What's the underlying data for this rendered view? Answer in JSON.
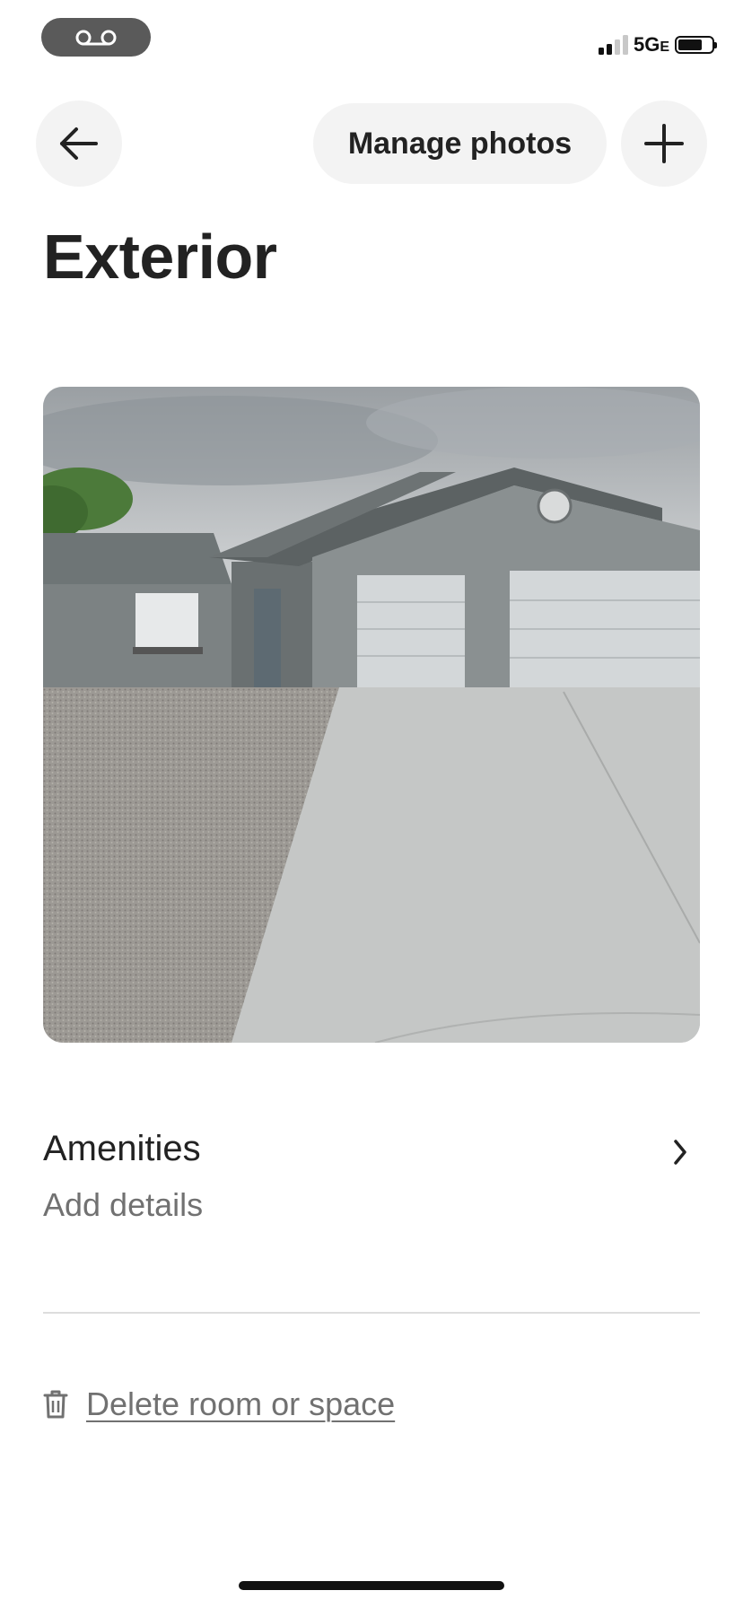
{
  "status_bar": {
    "network": "5G",
    "network_suffix": "E",
    "icons": [
      "voicemail-icon",
      "signal-icon",
      "battery-icon"
    ]
  },
  "header": {
    "back_icon": "arrow-left-icon",
    "manage_photos_label": "Manage photos",
    "add_icon": "plus-icon"
  },
  "page": {
    "title": "Exterior"
  },
  "photo": {
    "description_icon": "house-exterior-photo"
  },
  "amenities": {
    "title": "Amenities",
    "subtitle": "Add details",
    "chevron_icon": "chevron-right-icon"
  },
  "delete": {
    "label": "Delete room or space",
    "icon": "trash-icon"
  },
  "colors": {
    "text_primary": "#222222",
    "text_secondary": "#717171",
    "button_bg": "#f3f3f3",
    "divider": "#dddddd"
  }
}
